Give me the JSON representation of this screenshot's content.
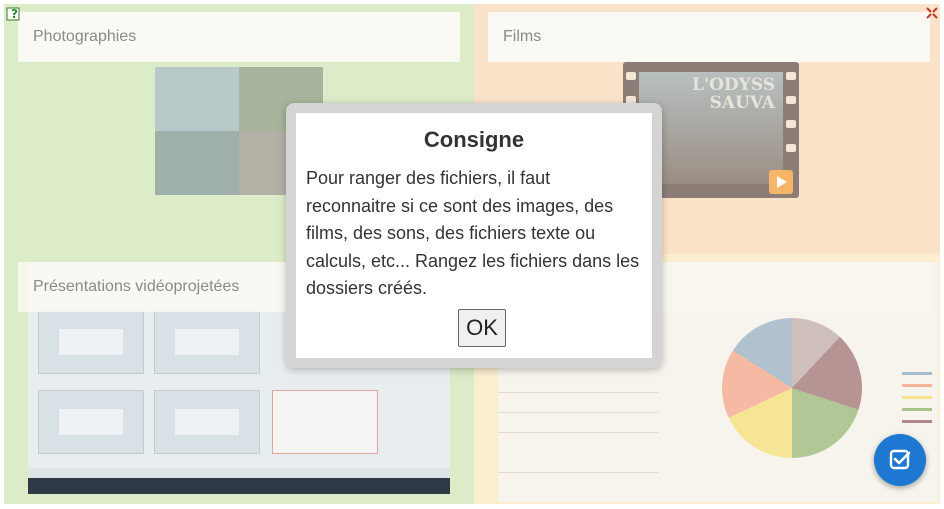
{
  "quadrants": {
    "photos": {
      "label": "Photographies"
    },
    "films": {
      "label": "Films",
      "thumbnail_title": "L'ODYSS\nSAUVA"
    },
    "presentations": {
      "label": "Présentations vidéoprojetées"
    },
    "calc": {
      "label": ""
    }
  },
  "dialog": {
    "title": "Consigne",
    "text": "Pour ranger des fichiers, il faut reconnaitre si ce sont des images, des films, des sons, des fichiers texte ou calculs, etc... Rangez les fichiers dans les dossiers créés.",
    "ok_label": "OK"
  },
  "icons": {
    "help": "help-icon",
    "fullscreen": "fullscreen-icon",
    "validate": "check-icon"
  },
  "colors": {
    "accent": "#1e78d2",
    "photos_bg": "#dcebc8",
    "films_bg": "#fbe3c9",
    "calc_bg": "#fbeecf"
  }
}
